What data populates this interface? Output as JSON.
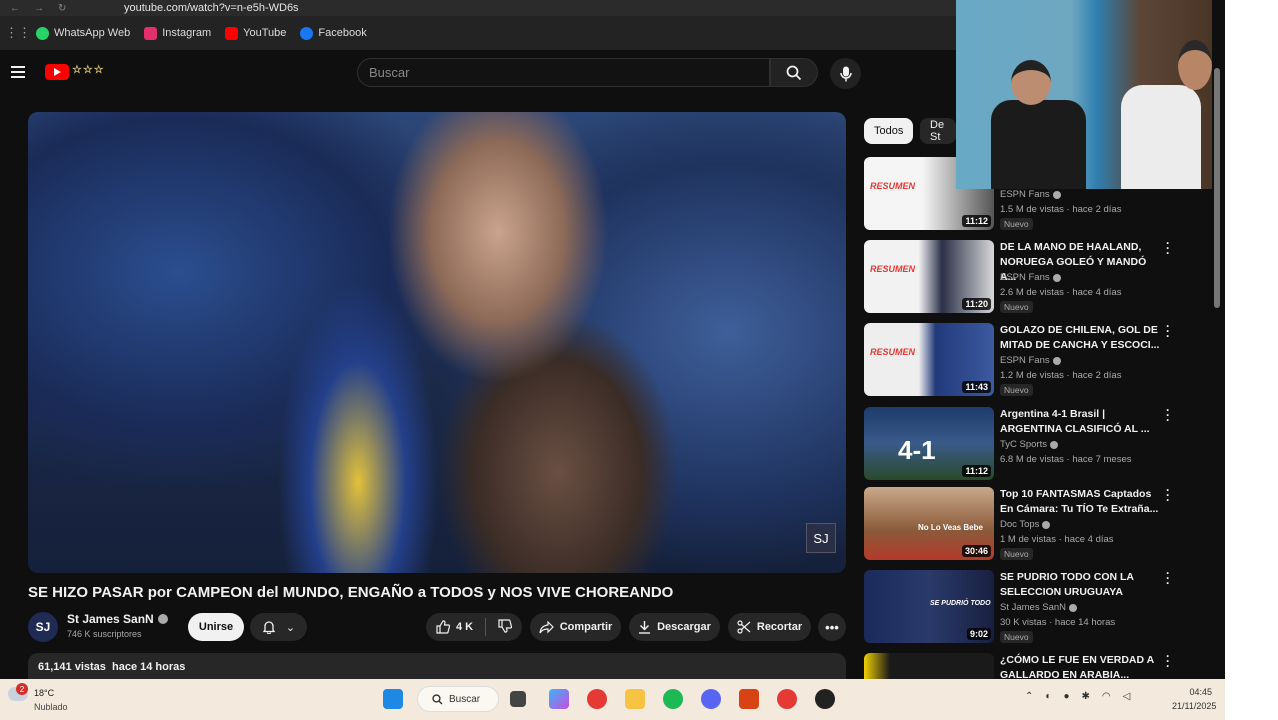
{
  "browser": {
    "url": "youtube.com/watch?v=n-e5h-WD6s",
    "bookmarks": [
      {
        "label": "WhatsApp Web",
        "icon": "whatsapp-icon",
        "color": "#25d366"
      },
      {
        "label": "Instagram",
        "icon": "instagram-icon",
        "color": "#e1306c"
      },
      {
        "label": "YouTube",
        "icon": "youtube-icon",
        "color": "#ff0000"
      },
      {
        "label": "Facebook",
        "icon": "facebook-icon",
        "color": "#1877f2"
      }
    ]
  },
  "header": {
    "search_placeholder": "Buscar"
  },
  "video": {
    "title": "SE HIZO PASAR por CAMPEON del MUNDO, ENGAÑO a TODOS y NOS VIVE CHOREANDO",
    "channel": "St James SanN",
    "subscribers": "746 K suscriptores",
    "subscribe_label": "Unirse",
    "likes": "4 K",
    "share_label": "Compartir",
    "download_label": "Descargar",
    "clip_label": "Recortar",
    "views": "61,141 vistas",
    "age": "hace 14 horas",
    "watermark": "SJ"
  },
  "chips": {
    "all": "Todos",
    "from": "De St"
  },
  "recommendations": [
    {
      "title": "",
      "channel": "ESPN Fans",
      "meta": "1.5 M de vistas · hace 2 días",
      "badge": "Nuevo",
      "duration": "11:12",
      "thumb_text": "RESUMEN",
      "thumb_bg": "#f5f5f5"
    },
    {
      "title": "DE LA MANO DE HAALAND, NORUEGA GOLEÓ Y MANDÓ A...",
      "channel": "ESPN Fans",
      "meta": "2.6 M de vistas · hace 4 días",
      "badge": "Nuevo",
      "duration": "11:20",
      "thumb_text": "RESUMEN",
      "thumb_bg": "#f2f2f2"
    },
    {
      "title": "GOLAZO DE CHILENA, GOL DE MITAD DE CANCHA Y ESCOCI...",
      "channel": "ESPN Fans",
      "meta": "1.2 M de vistas · hace 2 días",
      "badge": "Nuevo",
      "duration": "11:43",
      "thumb_text": "RESUMEN",
      "thumb_bg": "#eeeeee"
    },
    {
      "title": "Argentina 4-1 Brasil | ARGENTINA CLASIFICÓ AL ...",
      "channel": "TyC Sports",
      "meta": "6.8 M de vistas · hace 7 meses",
      "badge": "",
      "duration": "11:12",
      "thumb_text": "4-1",
      "thumb_bg": "#1d3b6b"
    },
    {
      "title": "Top 10 FANTASMAS Captados En Cámara: Tu TÍO Te Extraña...",
      "channel": "Doc Tops",
      "meta": "1 M de vistas · hace 4 días",
      "badge": "Nuevo",
      "duration": "30:46",
      "thumb_text": "No Lo Veas Bebe",
      "thumb_bg": "#8a5a3a"
    },
    {
      "title": "SE PUDRIO TODO CON LA SELECCION URUGUAYA",
      "channel": "St James SanN",
      "meta": "30 K vistas · hace 14 horas",
      "badge": "Nuevo",
      "duration": "9:02",
      "thumb_text": "SE PUDRIÓ TODO",
      "thumb_bg": "#2a3a6a"
    },
    {
      "title": "¿CÓMO LE FUE EN VERDAD A GALLARDO EN ARABIA...",
      "channel": "",
      "meta": "",
      "badge": "",
      "duration": "",
      "thumb_text": "",
      "thumb_bg": "#1a1a1a"
    }
  ],
  "taskbar": {
    "temp": "18°C",
    "condition": "Nublado",
    "notification_count": "2",
    "search_label": "Buscar",
    "time": "04:45",
    "date": "21/11/2025"
  }
}
